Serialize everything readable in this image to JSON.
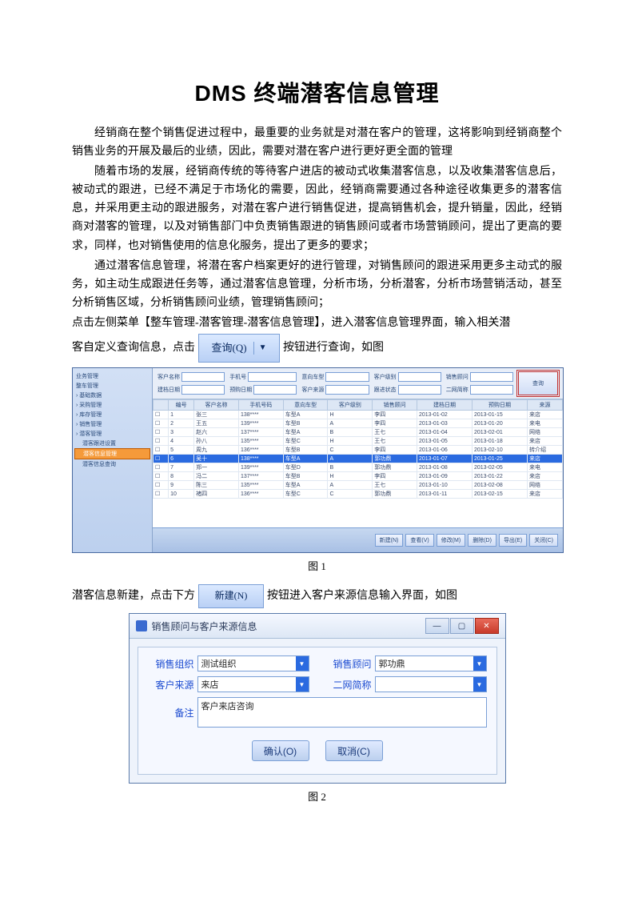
{
  "title": "DMS 终端潜客信息管理",
  "para1": "经销商在整个销售促进过程中，最重要的业务就是对潜在客户的管理，这将影响到经销商整个销售业务的开展及最后的业绩，因此，需要对潜在客户进行更好更全面的管理",
  "para2": "随着市场的发展，经销商传统的等待客户进店的被动式收集潜客信息，以及收集潜客信息后，被动式的跟进，已经不满足于市场化的需要，因此，经销商需要通过各种途径收集更多的潜客信息，并采用更主动的跟进服务，对潜在客户进行销售促进，提高销售机会，提升销量，因此，经销商对潜客的管理，以及对销售部门中负责销售跟进的销售顾问或者市场营销顾问，提出了更高的要求，同样，也对销售使用的信息化服务，提出了更多的要求；",
  "para3": "通过潜客信息管理，将潜在客户档案更好的进行管理，对销售顾问的跟进采用更多主动式的服务，如主动生成跟进任务等，通过潜客信息管理，分析市场，分析潜客，分析市场营销活动，甚至分析销售区域，分析销售顾问业绩，管理销售顾问；",
  "para4": "点击左侧菜单【整车管理-潜客管理-潜客信息管理】，进入潜客信息管理界面，输入相关潜",
  "inline1": {
    "a": "客自定义查询信息，点击",
    "btn": "查询(Q)",
    "b": "按钮进行查询，如图"
  },
  "caption1": "图 1",
  "inline2": {
    "a": "潜客信息新建，点击下方",
    "btn": "新建(N)",
    "b": "按钮进入客户来源信息输入界面，如图"
  },
  "caption2": "图 2",
  "shot1": {
    "side_items": [
      "业务管理",
      "整车管理",
      "› 基础数据",
      "› 采购管理",
      "› 库存管理",
      "› 销售管理",
      "› 潜客管理"
    ],
    "side_sub": [
      "潜客跟进设置",
      "潜客信息管理",
      "潜客信息查询"
    ],
    "filter_labels": [
      "客户名称",
      "手机号",
      "意向车型",
      "客户级别",
      "销售顾问",
      "建档日期",
      "预购日期",
      "客户来源",
      "跟进状态",
      "二网简称"
    ],
    "qbtn": "查询",
    "grid_head": [
      "",
      "编号",
      "客户名称",
      "手机号码",
      "意向车型",
      "客户级别",
      "销售顾问",
      "建档日期",
      "预购日期",
      "来源"
    ],
    "grid_rows": [
      [
        "1",
        "张三",
        "138****",
        "车型A",
        "H",
        "李四",
        "2013-01-02",
        "2013-01-15",
        "来店"
      ],
      [
        "2",
        "王五",
        "139****",
        "车型B",
        "A",
        "李四",
        "2013-01-03",
        "2013-01-20",
        "来电"
      ],
      [
        "3",
        "赵六",
        "137****",
        "车型A",
        "B",
        "王七",
        "2013-01-04",
        "2013-02-01",
        "网络"
      ],
      [
        "4",
        "孙八",
        "135****",
        "车型C",
        "H",
        "王七",
        "2013-01-05",
        "2013-01-18",
        "来店"
      ],
      [
        "5",
        "周九",
        "136****",
        "车型B",
        "C",
        "李四",
        "2013-01-06",
        "2013-02-10",
        "转介绍"
      ],
      [
        "6",
        "吴十",
        "138****",
        "车型A",
        "A",
        "郭功鼎",
        "2013-01-07",
        "2013-01-25",
        "来店"
      ],
      [
        "7",
        "郑一",
        "139****",
        "车型D",
        "B",
        "郭功鼎",
        "2013-01-08",
        "2013-02-05",
        "来电"
      ],
      [
        "8",
        "冯二",
        "137****",
        "车型B",
        "H",
        "李四",
        "2013-01-09",
        "2013-01-22",
        "来店"
      ],
      [
        "9",
        "陈三",
        "135****",
        "车型A",
        "A",
        "王七",
        "2013-01-10",
        "2013-02-08",
        "网络"
      ],
      [
        "10",
        "褚四",
        "136****",
        "车型C",
        "C",
        "郭功鼎",
        "2013-01-11",
        "2013-02-15",
        "来店"
      ]
    ],
    "foot_btns": [
      "新建(N)",
      "查看(V)",
      "修改(M)",
      "删除(D)",
      "导出(E)",
      "关闭(C)"
    ]
  },
  "shot2": {
    "title": "销售顾问与客户来源信息",
    "rows": [
      {
        "l1": "销售组织",
        "v1": "测试组织",
        "l2": "销售顾问",
        "v2": "郭功鼎"
      },
      {
        "l1": "客户来源",
        "v1": "来店",
        "l2": "二网简称",
        "v2": ""
      }
    ],
    "memo_label": "备注",
    "memo_value": "客户来店咨询",
    "ok": "确认(O)",
    "cancel": "取消(C)"
  }
}
